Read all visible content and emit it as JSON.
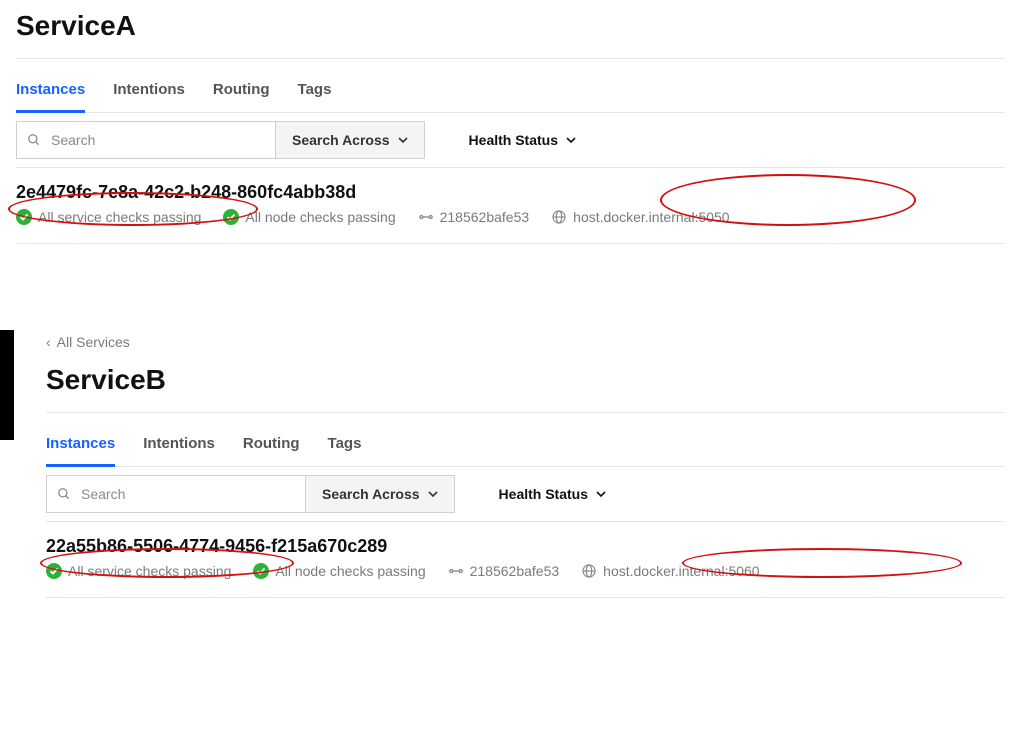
{
  "serviceA": {
    "title": "ServiceA",
    "tabs": {
      "instances": "Instances",
      "intentions": "Intentions",
      "routing": "Routing",
      "tags": "Tags"
    },
    "search": {
      "placeholder": "Search",
      "across_label": "Search Across",
      "health_label": "Health Status"
    },
    "instance": {
      "id": "2e4479fc-7e8a-42c2-b248-860fc4abb38d",
      "service_checks": "All service checks passing",
      "node_checks": "All node checks passing",
      "node": "218562bafe53",
      "address": "host.docker.internal:5050"
    }
  },
  "serviceB": {
    "back": "All Services",
    "title": "ServiceB",
    "tabs": {
      "instances": "Instances",
      "intentions": "Intentions",
      "routing": "Routing",
      "tags": "Tags"
    },
    "search": {
      "placeholder": "Search",
      "across_label": "Search Across",
      "health_label": "Health Status"
    },
    "instance": {
      "id": "22a55b86-5506-4774-9456-f215a670c289",
      "service_checks": "All service checks passing",
      "node_checks": "All node checks passing",
      "node": "218562bafe53",
      "address": "host.docker.internal:5060"
    }
  }
}
